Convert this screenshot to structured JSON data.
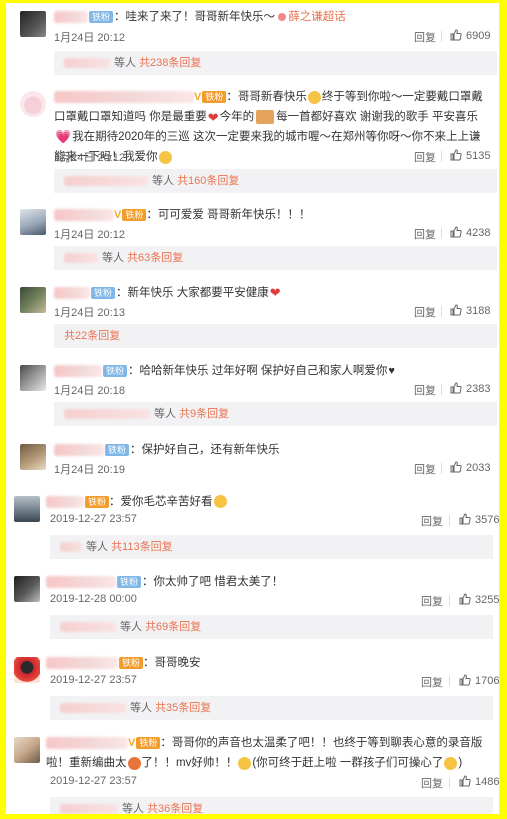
{
  "colors": {
    "frame": "#ffff00",
    "accent": "#eb7350",
    "fan_badge": "#7fb7e8",
    "iron_badge": "#f39b2b",
    "reply_bg": "#f2f2f5"
  },
  "labels": {
    "reply": "回复",
    "fan_badge": "铁粉",
    "iron_badge": "铁粉"
  },
  "comments": [
    {
      "text_after": "：哇来了来了！哥哥新年快乐～",
      "suffix_link": "薛之谦超话",
      "time": "1月24日 20:12",
      "likes": "6909",
      "replies_summary": {
        "prefix": "等人",
        "count_text": "共238条回复"
      }
    },
    {
      "text_a": "：哥哥新春快乐",
      "text_b": "终于等到你啦～一定要戴口罩戴口罩戴口罩知道吗 你是最重要",
      "text_c": "今年的",
      "text_d": "每一首都好喜欢 谢谢我的歌手 平安喜乐",
      "text_e": "我在期待2020年的三巡 这次一定要来我的城市喔～在郑州等你呀～你不来上上谦能来一下吗！我爱你",
      "time": "1月24日 20:12",
      "likes": "5135",
      "replies_summary": {
        "prefix": "等人",
        "count_text": "共160条回复"
      }
    },
    {
      "text_after": "：可可爱爱 哥哥新年快乐！！！",
      "time": "1月24日 20:12",
      "likes": "4238",
      "replies_summary": {
        "prefix": "等人",
        "count_text": "共63条回复"
      }
    },
    {
      "text_after": "：新年快乐  大家都要平安健康",
      "time": "1月24日 20:13",
      "likes": "3188",
      "replies_summary": {
        "prefix": "",
        "count_text": "共22条回复"
      }
    },
    {
      "text_after": "：哈哈新年快乐  过年好啊  保护好自己和家人啊爱你",
      "time": "1月24日 20:18",
      "likes": "2383",
      "replies_summary": {
        "prefix": "等人",
        "count_text": "共9条回复"
      }
    },
    {
      "text_after": "：保护好自己，还有新年快乐",
      "time": "1月24日 20:19",
      "likes": "2033"
    },
    {
      "text_after": "：爱你毛芯辛苦好看",
      "time": "2019-12-27 23:57",
      "likes": "3576",
      "replies_summary": {
        "prefix": "等人",
        "count_text": "共113条回复"
      }
    },
    {
      "text_after": "：你太帅了吧 惜君太美了！",
      "time": "2019-12-28 00:00",
      "likes": "3255",
      "replies_summary": {
        "prefix": "等人",
        "count_text": "共69条回复"
      }
    },
    {
      "text_after": "：哥哥晚安",
      "time": "2019-12-27 23:57",
      "likes": "1706",
      "replies_summary": {
        "prefix": "等人",
        "count_text": "共35条回复"
      }
    },
    {
      "text_a": "：哥哥你的声音也太温柔了吧！！也终于等到聊表心意的录音版啦！重新编曲太",
      "text_b": "了！！mv好帅！！",
      "text_c": "(你可终于赶上啦 一群孩子们可操心了",
      "text_d": ")",
      "time": "2019-12-27 23:57",
      "likes": "1486",
      "replies_summary": {
        "prefix": "等人",
        "count_text": "共36条回复"
      }
    }
  ]
}
